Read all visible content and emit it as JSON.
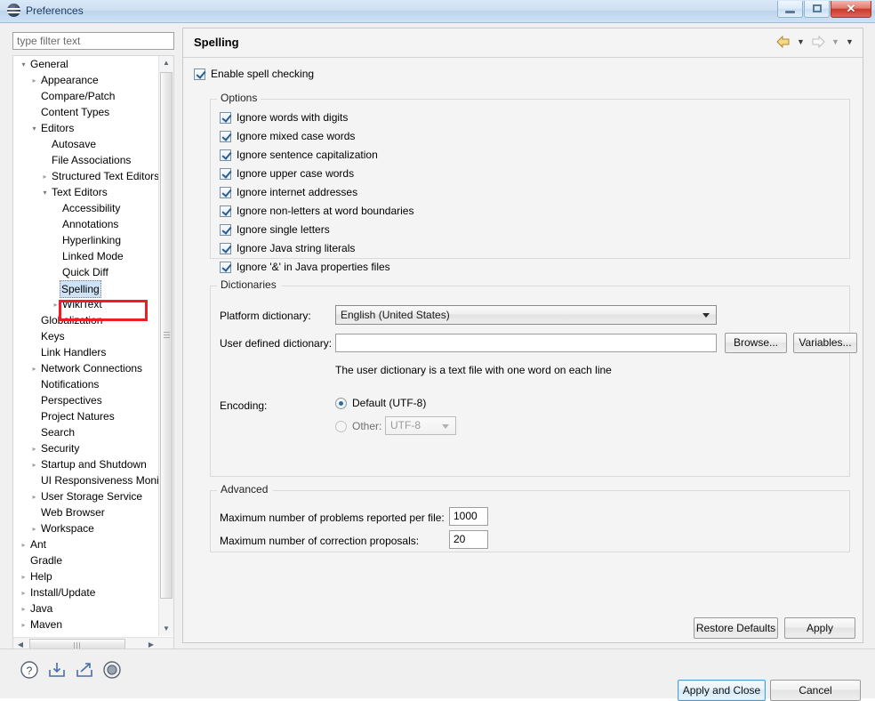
{
  "window": {
    "title": "Preferences",
    "app_icon": "eclipse-icon",
    "buttons": {
      "minimize": "minimize-button",
      "maximize": "maximize-button",
      "close": "✕"
    }
  },
  "sidebar": {
    "filter": {
      "value": "",
      "placeholder": "type filter text"
    },
    "tree": [
      {
        "label": "General",
        "depth": 0,
        "twisty": "expanded"
      },
      {
        "label": "Appearance",
        "depth": 1,
        "twisty": "collapsed"
      },
      {
        "label": "Compare/Patch",
        "depth": 1,
        "twisty": "none"
      },
      {
        "label": "Content Types",
        "depth": 1,
        "twisty": "none"
      },
      {
        "label": "Editors",
        "depth": 1,
        "twisty": "expanded"
      },
      {
        "label": "Autosave",
        "depth": 2,
        "twisty": "none"
      },
      {
        "label": "File Associations",
        "depth": 2,
        "twisty": "none"
      },
      {
        "label": "Structured Text Editors",
        "depth": 2,
        "twisty": "collapsed"
      },
      {
        "label": "Text Editors",
        "depth": 2,
        "twisty": "expanded"
      },
      {
        "label": "Accessibility",
        "depth": 3,
        "twisty": "none"
      },
      {
        "label": "Annotations",
        "depth": 3,
        "twisty": "none"
      },
      {
        "label": "Hyperlinking",
        "depth": 3,
        "twisty": "none"
      },
      {
        "label": "Linked Mode",
        "depth": 3,
        "twisty": "none"
      },
      {
        "label": "Quick Diff",
        "depth": 3,
        "twisty": "none"
      },
      {
        "label": "Spelling",
        "depth": 3,
        "twisty": "none",
        "selected": true
      },
      {
        "label": "WikiText",
        "depth": 3,
        "twisty": "collapsed"
      },
      {
        "label": "Globalization",
        "depth": 1,
        "twisty": "none"
      },
      {
        "label": "Keys",
        "depth": 1,
        "twisty": "none"
      },
      {
        "label": "Link Handlers",
        "depth": 1,
        "twisty": "none"
      },
      {
        "label": "Network Connections",
        "depth": 1,
        "twisty": "collapsed"
      },
      {
        "label": "Notifications",
        "depth": 1,
        "twisty": "none"
      },
      {
        "label": "Perspectives",
        "depth": 1,
        "twisty": "none"
      },
      {
        "label": "Project Natures",
        "depth": 1,
        "twisty": "none"
      },
      {
        "label": "Search",
        "depth": 1,
        "twisty": "none"
      },
      {
        "label": "Security",
        "depth": 1,
        "twisty": "collapsed"
      },
      {
        "label": "Startup and Shutdown",
        "depth": 1,
        "twisty": "collapsed"
      },
      {
        "label": "UI Responsiveness Monitoring",
        "depth": 1,
        "twisty": "none"
      },
      {
        "label": "User Storage Service",
        "depth": 1,
        "twisty": "collapsed"
      },
      {
        "label": "Web Browser",
        "depth": 1,
        "twisty": "none"
      },
      {
        "label": "Workspace",
        "depth": 1,
        "twisty": "collapsed"
      },
      {
        "label": "Ant",
        "depth": 0,
        "twisty": "collapsed"
      },
      {
        "label": "Gradle",
        "depth": 0,
        "twisty": "none"
      },
      {
        "label": "Help",
        "depth": 0,
        "twisty": "collapsed"
      },
      {
        "label": "Install/Update",
        "depth": 0,
        "twisty": "collapsed"
      },
      {
        "label": "Java",
        "depth": 0,
        "twisty": "collapsed"
      },
      {
        "label": "Maven",
        "depth": 0,
        "twisty": "collapsed"
      }
    ]
  },
  "page": {
    "title": "Spelling",
    "nav": {
      "back": "back-arrow",
      "back_menu": "▼",
      "forward": "forward-arrow",
      "forward_menu": "▼",
      "view_menu": "▼"
    },
    "enable_spell_checking": {
      "label": "Enable spell checking",
      "checked": true
    },
    "options": {
      "legend": "Options",
      "items": [
        {
          "label": "Ignore words with digits",
          "checked": true
        },
        {
          "label": "Ignore mixed case words",
          "checked": true
        },
        {
          "label": "Ignore sentence capitalization",
          "checked": true
        },
        {
          "label": "Ignore upper case words",
          "checked": true
        },
        {
          "label": "Ignore internet addresses",
          "checked": true
        },
        {
          "label": "Ignore non-letters at word boundaries",
          "checked": true
        },
        {
          "label": "Ignore single letters",
          "checked": true
        },
        {
          "label": "Ignore Java string literals",
          "checked": true
        },
        {
          "label": "Ignore '&' in Java properties files",
          "checked": true
        }
      ]
    },
    "dictionaries": {
      "legend": "Dictionaries",
      "platform_label": "Platform dictionary:",
      "platform_value": "English (United States)",
      "user_label": "User defined dictionary:",
      "user_value": "",
      "browse_button": "Browse...",
      "variables_button": "Variables...",
      "hint": "The user dictionary is a text file with one word on each line",
      "encoding_label": "Encoding:",
      "encoding_default": {
        "label": "Default (UTF-8)",
        "selected": true
      },
      "encoding_other": {
        "label": "Other:",
        "selected": false
      },
      "encoding_other_value": "UTF-8"
    },
    "advanced": {
      "legend": "Advanced",
      "max_problems_label": "Maximum number of problems reported per file:",
      "max_problems_value": "1000",
      "max_proposals_label": "Maximum number of correction proposals:",
      "max_proposals_value": "20"
    },
    "restore_defaults_button": "Restore Defaults",
    "apply_button": "Apply"
  },
  "footer": {
    "icons": [
      "help-icon",
      "import-icon",
      "export-icon",
      "target-icon"
    ],
    "apply_and_close_button": "Apply and Close",
    "cancel_button": "Cancel"
  },
  "annotation": {
    "color": "#ee1c24",
    "target": "Spelling"
  }
}
